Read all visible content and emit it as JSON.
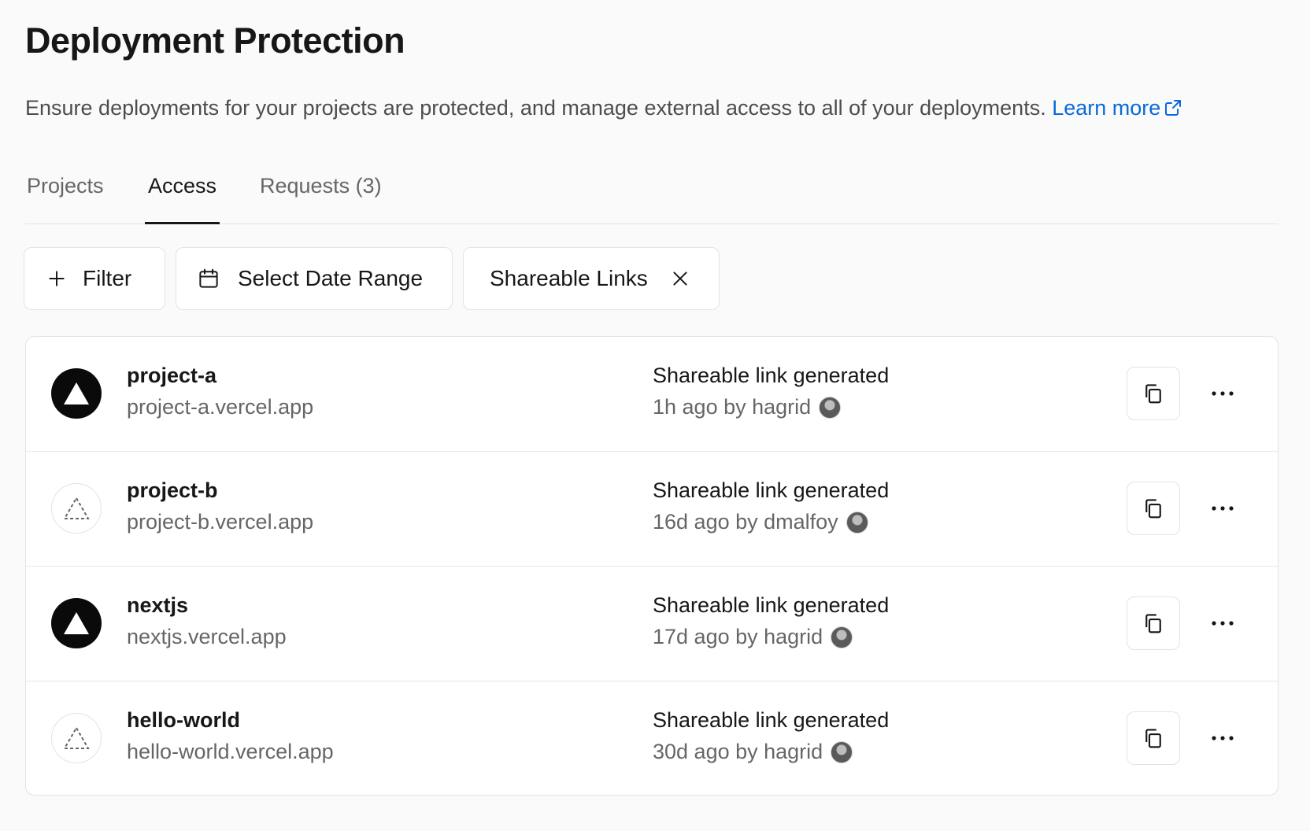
{
  "page": {
    "title": "Deployment Protection",
    "description": "Ensure deployments for your projects are protected, and manage external access to all of your deployments.",
    "learn_more": "Learn more",
    "link_color": "#0969da"
  },
  "tabs": [
    {
      "label": "Projects",
      "active": false
    },
    {
      "label": "Access",
      "active": true
    },
    {
      "label": "Requests (3)",
      "active": false
    }
  ],
  "filters": {
    "filter_label": "Filter",
    "date_range_label": "Select Date Range",
    "active_filter_label": "Shareable Links",
    "icons": [
      "plus-icon",
      "calendar-icon",
      "close-icon"
    ]
  },
  "rows": [
    {
      "name": "project-a",
      "url": "project-a.vercel.app",
      "event": "Shareable link generated",
      "meta": "1h ago by hagrid",
      "icon": "solid-triangle-icon"
    },
    {
      "name": "project-b",
      "url": "project-b.vercel.app",
      "event": "Shareable link generated",
      "meta": "16d ago by dmalfoy",
      "icon": "dashed-triangle-icon"
    },
    {
      "name": "nextjs",
      "url": "nextjs.vercel.app",
      "event": "Shareable link generated",
      "meta": "17d ago by hagrid",
      "icon": "solid-triangle-icon"
    },
    {
      "name": "hello-world",
      "url": "hello-world.vercel.app",
      "event": "Shareable link generated",
      "meta": "30d ago by hagrid",
      "icon": "dashed-triangle-icon"
    }
  ],
  "row_actions": [
    "copy-icon",
    "more-icon"
  ]
}
